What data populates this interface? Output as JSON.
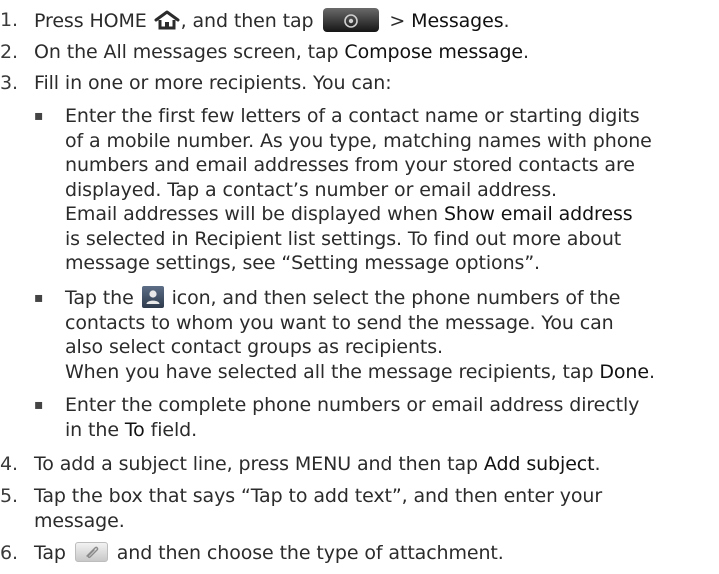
{
  "steps": [
    {
      "number": "1.",
      "text_a": "Press HOME ",
      "icon_home": "home-icon",
      "text_b": ", and then tap ",
      "icon_app": "all-apps-icon",
      "text_c": " > ",
      "ui_messages": "Messages",
      "text_d": "."
    },
    {
      "number": "2.",
      "text_a": "On the All messages screen, tap ",
      "ui_compose": "Compose message",
      "text_b": "."
    },
    {
      "number": "3.",
      "text": "Fill in one or more recipients. You can:",
      "bullets": [
        {
          "lines": [
            "Enter the first few letters of a contact name or starting digits",
            "of a mobile number. As you type, matching names with phone",
            "numbers and email addresses from your stored contacts are",
            "displayed. Tap a contact’s number or email address."
          ],
          "line5_a": "Email addresses will be displayed when ",
          "line5_ui": "Show email address",
          "line6": "is selected in Recipient list settings. To find out more about",
          "line7": "message settings, see “Setting message options”."
        },
        {
          "line1_a": "Tap the ",
          "icon_contact": "contact-icon",
          "line1_b": " icon, and then select the phone numbers of the",
          "line2": "contacts to whom you want to send the message. You can",
          "line3": "also select contact groups as recipients.",
          "line4_a": "When you have selected all the message recipients, tap ",
          "line4_ui": "Done",
          "line4_b": "."
        },
        {
          "line1": "Enter the complete phone numbers or email address directly",
          "line2_a": "in the ",
          "line2_ui": "To",
          "line2_b": " field."
        }
      ]
    },
    {
      "number": "4.",
      "text_a": "To add a subject line, press MENU and then tap ",
      "ui_subject": "Add subject",
      "text_b": "."
    },
    {
      "number": "5.",
      "line1": "Tap the box that says “Tap to add text”, and then enter your",
      "line2": "message."
    },
    {
      "number": "6.",
      "text_a": "Tap ",
      "icon_attach": "attachment-icon",
      "text_b": " and then choose the type of attachment."
    }
  ],
  "bullet_glyph": "▪",
  "colors": {
    "text": "#2b2b2b",
    "ui_text": "#111111",
    "app_button": "#2a2a2a",
    "contact_icon": "#3d4a5e"
  }
}
